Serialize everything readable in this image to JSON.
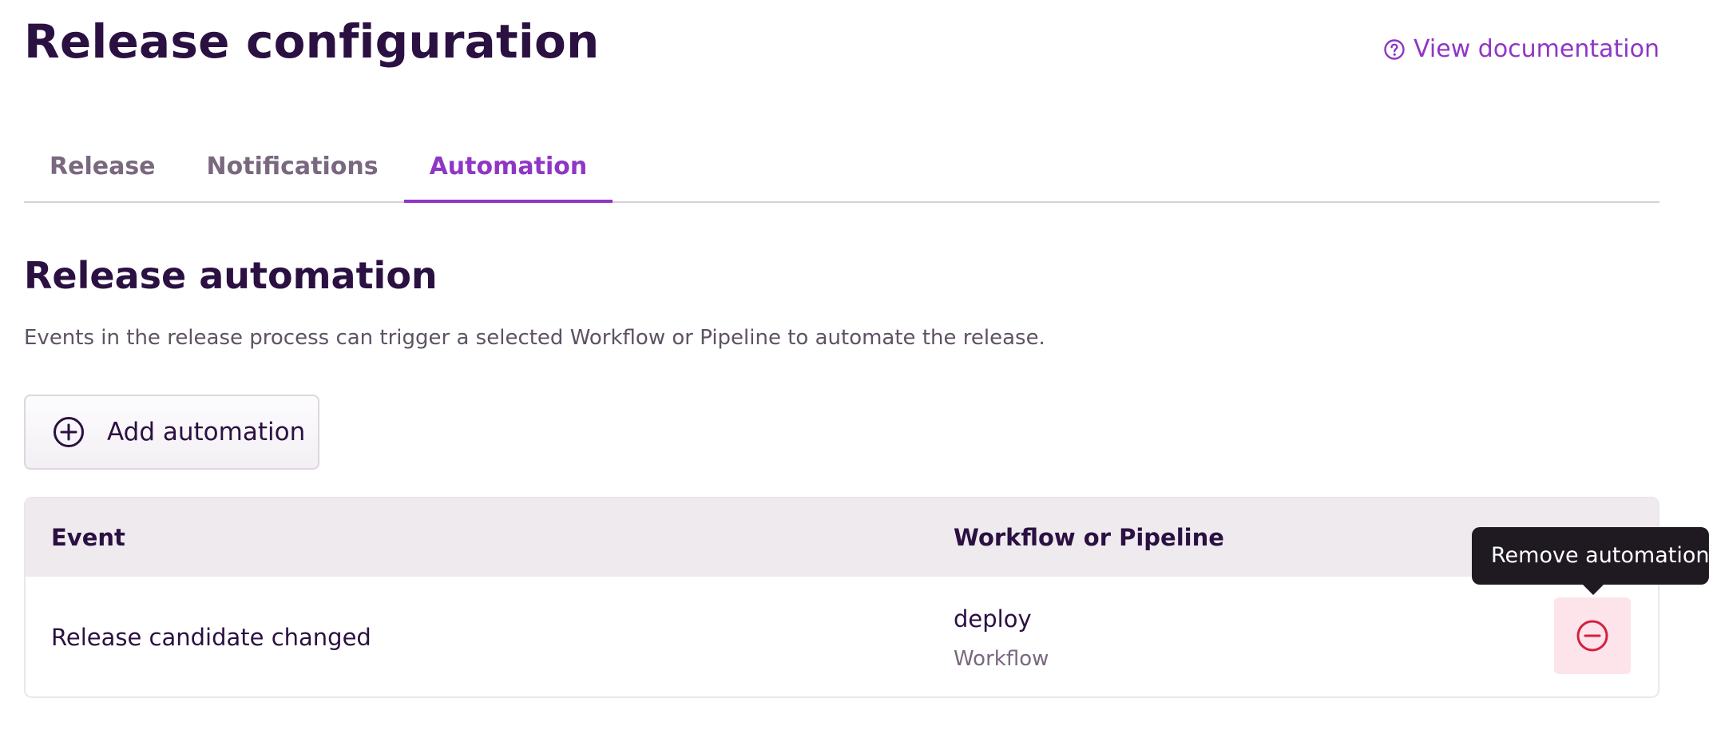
{
  "header": {
    "title": "Release configuration",
    "doc_link_label": "View documentation",
    "doc_icon": "help-circle-icon"
  },
  "tabs": [
    {
      "label": "Release",
      "active": false
    },
    {
      "label": "Notifications",
      "active": false
    },
    {
      "label": "Automation",
      "active": true
    }
  ],
  "automation": {
    "title": "Release automation",
    "description": "Events in the release process can trigger a selected Workflow or Pipeline to automate the release.",
    "add_button_label": "Add automation",
    "add_icon": "plus-circle-icon"
  },
  "table": {
    "columns": [
      "Event",
      "Workflow or Pipeline"
    ],
    "rows": [
      {
        "event": "Release candidate changed",
        "workflow_name": "deploy",
        "workflow_type": "Workflow",
        "remove_icon": "minus-circle-icon"
      }
    ]
  },
  "tooltip": {
    "text": "Remove automation"
  },
  "colors": {
    "accent": "#8f36c6",
    "heading": "#2b1042",
    "danger": "#d3213f",
    "danger_bg": "#fde3ea",
    "tooltip_bg": "#1f1a22",
    "table_header_bg": "#efeaee"
  }
}
